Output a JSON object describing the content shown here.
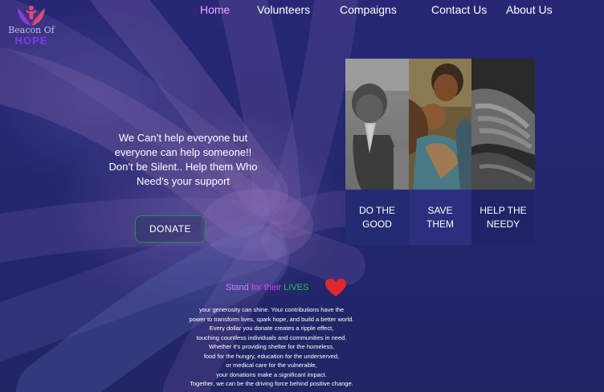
{
  "logo": {
    "line1": "Beacon Of",
    "line2": "HOPE",
    "icon": "hands-heart-logo-icon"
  },
  "nav": {
    "items": [
      {
        "label": "Home",
        "active": true
      },
      {
        "label": "Volunteers",
        "active": false
      },
      {
        "label": "Compaigns",
        "active": false
      },
      {
        "label": "Contact Us",
        "active": false
      },
      {
        "label": "About Us",
        "active": false
      }
    ],
    "active_color": "#f3a6ff"
  },
  "hero": {
    "tagline_lines": [
      "We Can’t help everyone but",
      "everyone can help someone!!",
      "Don’t be Silent.. Help them Who",
      "Need’s your support"
    ],
    "donate_label": "DONATE",
    "donate_border_color": "#2e8b57"
  },
  "collage": {
    "panels": [
      {
        "caption_lines": [
          "DO THE",
          "GOOD"
        ],
        "photo": "praying-child-photo"
      },
      {
        "caption_lines": [
          "SAVE",
          "THEM"
        ],
        "photo": "children-embrace-photo"
      },
      {
        "caption_lines": [
          "HELP THE",
          "NEEDY"
        ],
        "photo": "elderly-hands-photo"
      }
    ]
  },
  "stand": {
    "word1": "Stand",
    "word2": "for their",
    "word3": "LIVES",
    "heart_color": "#e0282e"
  },
  "paragraph_lines": [
    "your generosity can shine. Your contributions have the",
    "power to transform lives, spark hope, and build a better world.",
    "Every dollar you donate creates a ripple effect,",
    "touching countless individuals and communities in need.",
    "Whether it's providing shelter for the homeless,",
    "food for the hungry, education for the underserved,",
    "or medical care for the vulnerable,",
    "your donations make a significant impact.",
    "Together, we can be the driving force behind positive change."
  ]
}
